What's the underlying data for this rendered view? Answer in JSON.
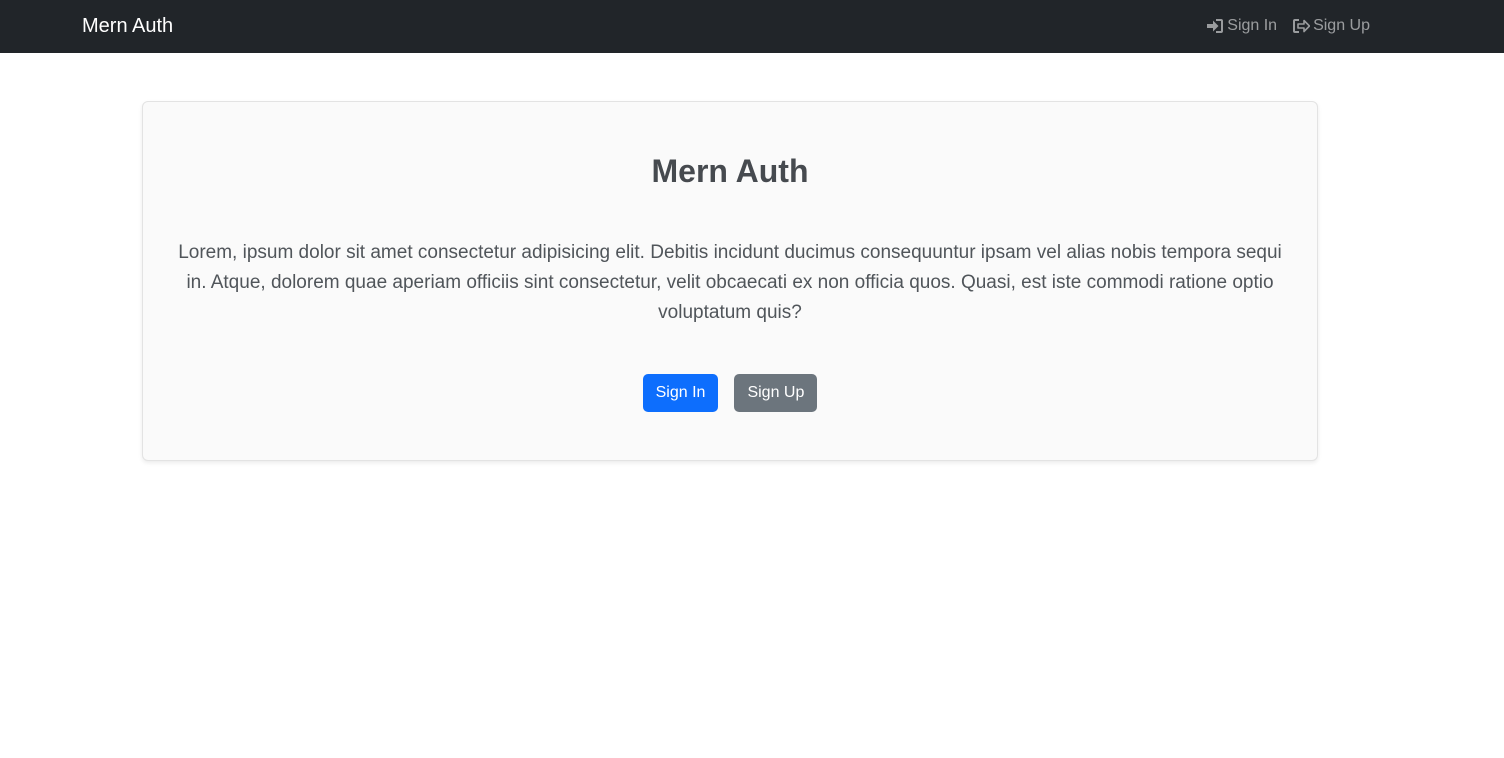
{
  "navbar": {
    "brand": "Mern Auth",
    "links": [
      {
        "label": "Sign In",
        "icon": "sign-in-icon"
      },
      {
        "label": "Sign Up",
        "icon": "sign-out-icon"
      }
    ]
  },
  "hero": {
    "title": "Mern Auth",
    "text": "Lorem, ipsum dolor sit amet consectetur adipisicing elit. Debitis incidunt ducimus consequuntur ipsam vel alias nobis tempora sequi in. Atque, dolorem quae aperiam officiis sint consectetur, velit obcaecati ex non officia quos. Quasi, est iste commodi ratione optio voluptatum quis?",
    "primary_button": "Sign In",
    "secondary_button": "Sign Up"
  },
  "colors": {
    "navbar_bg": "#212529",
    "primary": "#0d6efd",
    "secondary": "#6c757d"
  }
}
